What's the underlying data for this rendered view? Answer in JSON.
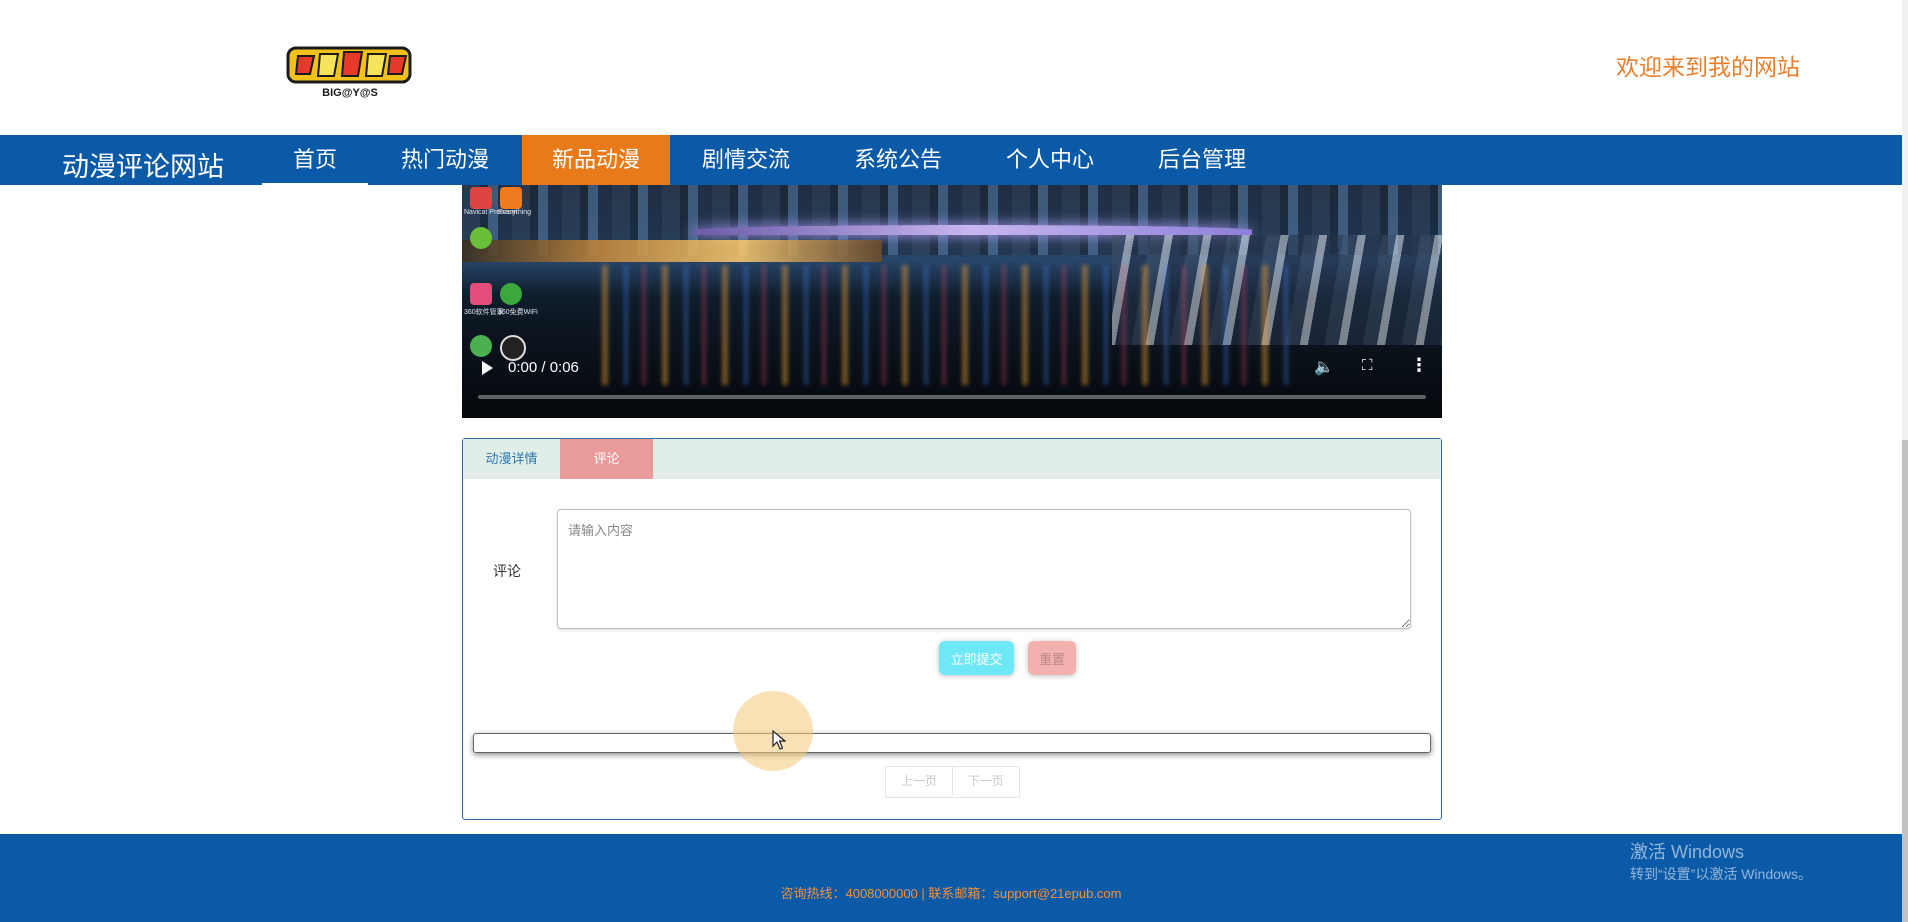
{
  "header": {
    "logo_text": "BIG@Y@S",
    "welcome": "欢迎来到我的网站"
  },
  "nav": {
    "brand": "动漫评论网站",
    "items": [
      {
        "label": "首页"
      },
      {
        "label": "热门动漫"
      },
      {
        "label": "新品动漫",
        "active": true
      },
      {
        "label": "剧情交流"
      },
      {
        "label": "系统公告"
      },
      {
        "label": "个人中心"
      },
      {
        "label": "后台管理"
      }
    ]
  },
  "video": {
    "time": "0:00 / 0:06",
    "progress": 0,
    "desktop_icon_labels": [
      "Navicat Premium",
      "Everything",
      "360软件管家",
      "360免费WiFi"
    ]
  },
  "panel": {
    "tabs": [
      {
        "label": "动漫详情"
      },
      {
        "label": "评论",
        "active": true
      }
    ],
    "comment_label": "评论",
    "comment_placeholder": "请输入内容",
    "submit_label": "立即提交",
    "reset_label": "重置",
    "prev_label": "上一页",
    "next_label": "下一页"
  },
  "footer": {
    "info": "咨询热线：4008000000 | 联系邮箱：support@21epub.com"
  },
  "windows_watermark": {
    "title": "激活 Windows",
    "subtitle": "转到“设置”以激活 Windows。"
  },
  "colors": {
    "nav_bg": "#0b5aa8",
    "nav_active": "#e97a1a",
    "accent_orange": "#e97f2c",
    "submit_bg": "#6ee8f7",
    "reset_bg": "#f2b0ae",
    "tab_active_bg": "#e99a9a"
  }
}
